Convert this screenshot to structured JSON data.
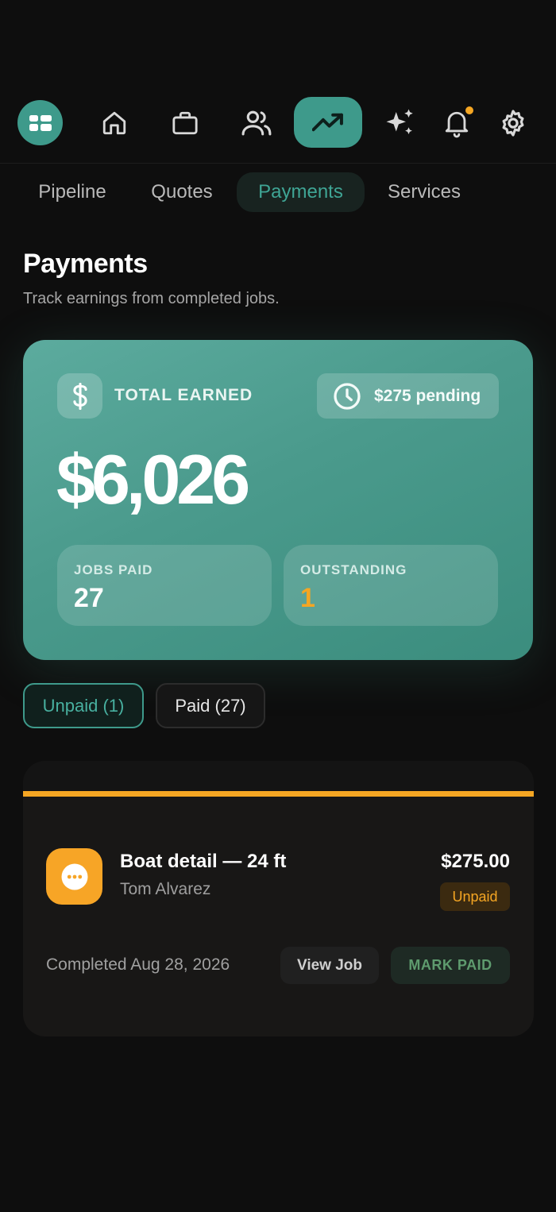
{
  "nav": {
    "icons": [
      "dashboard-logo-icon",
      "home-icon",
      "briefcase-icon",
      "users-icon",
      "trending-up-icon",
      "sparkles-icon",
      "bell-icon",
      "gear-icon"
    ],
    "active": "trending-up-icon",
    "accent": "#3e9a8b",
    "notification_dot_color": "#f5a623"
  },
  "tabs": [
    {
      "label": "Pipeline"
    },
    {
      "label": "Quotes"
    },
    {
      "label": "Payments"
    },
    {
      "label": "Services"
    }
  ],
  "active_tab": "Payments",
  "page": {
    "title": "Payments",
    "subtitle": "Track earnings from completed jobs."
  },
  "summary": {
    "total_label": "TOTAL EARNED",
    "pending": "$275 pending",
    "total": "$6,026",
    "stats": [
      {
        "label": "JOBS PAID",
        "value": "27"
      },
      {
        "label": "OUTSTANDING",
        "value": "1"
      }
    ]
  },
  "filters": [
    {
      "label": "Unpaid (1)",
      "active": true
    },
    {
      "label": "Paid (27)",
      "active": false
    }
  ],
  "job": {
    "title": "Boat detail — 24 ft",
    "client": "Tom Alvarez",
    "amount": "$275.00",
    "status": "Unpaid",
    "completed": "Completed Aug 28, 2026",
    "view_label": "View Job",
    "mark_label": "MARK PAID",
    "stripe_color": "#f5a623"
  }
}
